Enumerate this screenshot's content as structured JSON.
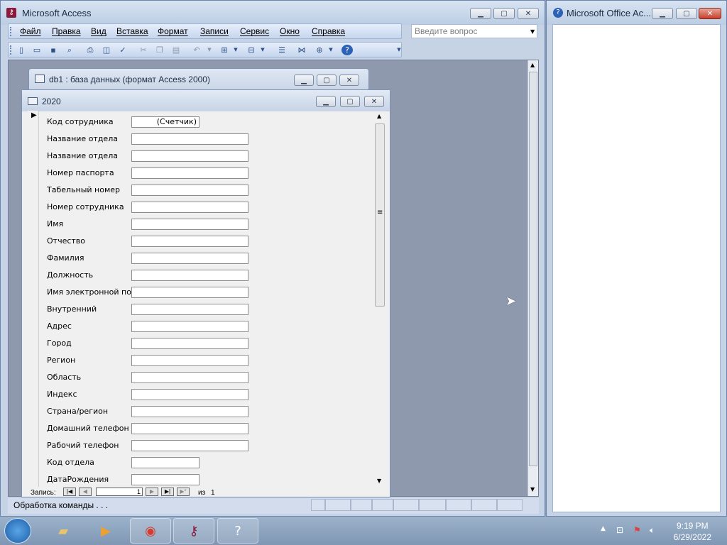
{
  "access": {
    "title": "Microsoft Access",
    "menu": [
      "Файл",
      "Правка",
      "Вид",
      "Вставка",
      "Формат",
      "Записи",
      "Сервис",
      "Окно",
      "Справка"
    ],
    "search_placeholder": "Введите вопрос",
    "toolbar_icons": [
      "new-icon",
      "open-icon",
      "save-icon",
      "file-search-icon",
      "print-icon",
      "print-preview-icon",
      "spelling-icon",
      "cut-icon",
      "copy-icon",
      "paste-icon",
      "undo-icon",
      "insert-object-icon",
      "office-links-icon",
      "properties-icon",
      "relationships-icon",
      "new-object-icon",
      "help-icon"
    ]
  },
  "db_window": {
    "title": "db1 : база данных (формат Access 2000)"
  },
  "form_window": {
    "title": "2020",
    "fields": [
      {
        "label": "Код сотрудника",
        "value": "(Счетчик)",
        "short": true
      },
      {
        "label": "Название отдела",
        "value": ""
      },
      {
        "label": "Название отдела",
        "value": ""
      },
      {
        "label": "Номер паспорта",
        "value": ""
      },
      {
        "label": "Табельный номер",
        "value": ""
      },
      {
        "label": "Номер сотрудника",
        "value": ""
      },
      {
        "label": "Имя",
        "value": ""
      },
      {
        "label": "Отчество",
        "value": ""
      },
      {
        "label": "Фамилия",
        "value": ""
      },
      {
        "label": "Должность",
        "value": ""
      },
      {
        "label": "Имя электронной почты",
        "value": ""
      },
      {
        "label": "Внутренний",
        "value": ""
      },
      {
        "label": "Адрес",
        "value": ""
      },
      {
        "label": "Город",
        "value": ""
      },
      {
        "label": "Регион",
        "value": ""
      },
      {
        "label": "Область",
        "value": ""
      },
      {
        "label": "Индекс",
        "value": ""
      },
      {
        "label": "Страна/регион",
        "value": ""
      },
      {
        "label": "Домашний телефон",
        "value": ""
      },
      {
        "label": "Рабочий телефон",
        "value": ""
      },
      {
        "label": "Код отдела",
        "value": "",
        "short": true
      },
      {
        "label": "ДатаРождения",
        "value": "",
        "short": true
      }
    ],
    "nav": {
      "label": "Запись:",
      "current": "1",
      "of_label": "из",
      "total": "1"
    }
  },
  "status": {
    "text": "Обработка команды . . ."
  },
  "task_pane": {
    "title": "Microsoft Office Ac..."
  },
  "taskbar": {
    "time": "9:19 PM",
    "date": "6/29/2022"
  }
}
